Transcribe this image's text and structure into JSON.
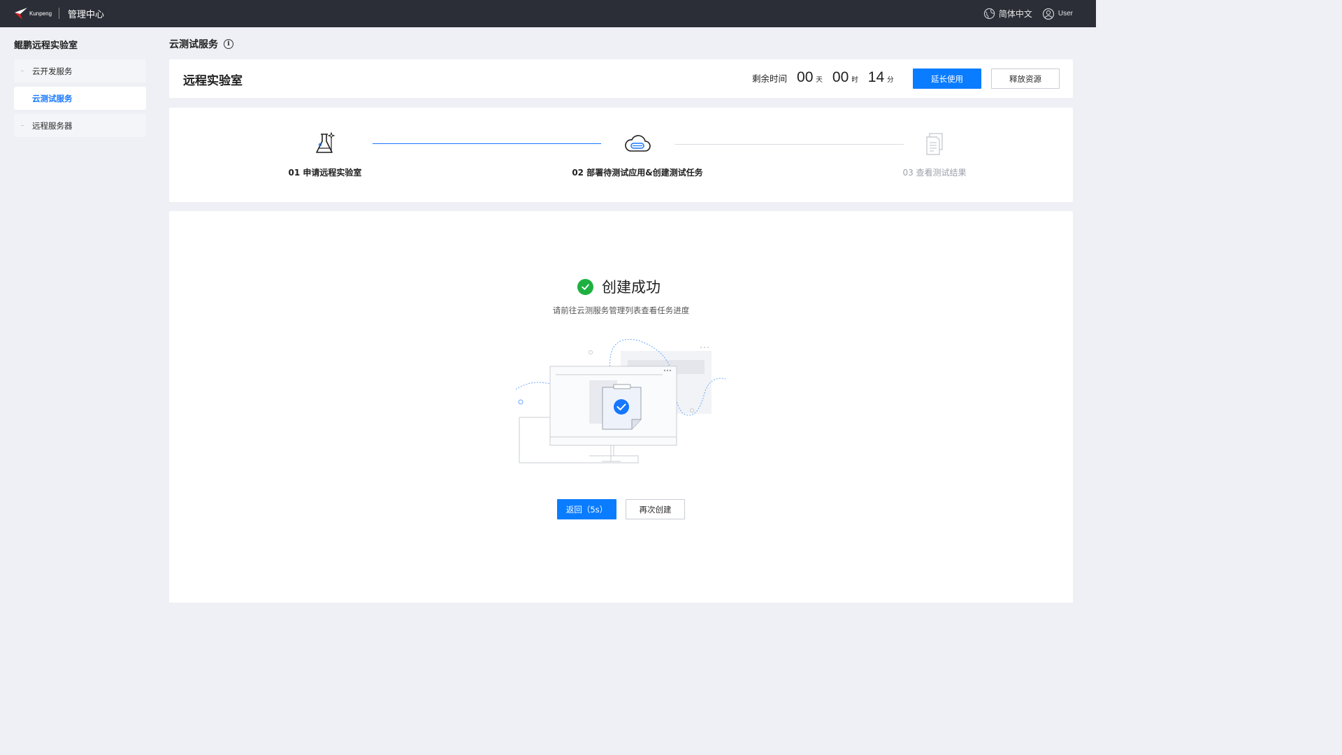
{
  "topbar": {
    "logo_text": "Kunpeng",
    "title": "管理中心",
    "language_label": "简体中文",
    "user_label": "User"
  },
  "sidebar": {
    "title": "鲲鹏远程实验室",
    "items": [
      {
        "label": "云开发服务",
        "active": false
      },
      {
        "label": "云测试服务",
        "active": true
      },
      {
        "label": "远程服务器",
        "active": false
      }
    ]
  },
  "page": {
    "title": "云测试服务",
    "info_icon": "info-icon"
  },
  "lab_header": {
    "title": "远程实验室",
    "remaining_label": "剩余时间",
    "days": "00",
    "days_unit": "天",
    "hours": "00",
    "hours_unit": "时",
    "minutes": "14",
    "minutes_unit": "分",
    "extend_button": "延长使用",
    "release_button": "释放资源"
  },
  "steps": [
    {
      "label": "01 申请远程实验室",
      "icon": "flask-icon",
      "state": "done"
    },
    {
      "label": "02 部署待测试应用&创建测试任务",
      "icon": "cloud-icon",
      "state": "current"
    },
    {
      "label": "03 查看测试结果",
      "icon": "document-icon",
      "state": "pending"
    }
  ],
  "result": {
    "title": "创建成功",
    "subtitle": "请前往云测服务管理列表查看任务进度",
    "back_button": "返回（5s）",
    "recreate_button": "再次创建"
  },
  "colors": {
    "topbar": "#2b2e36",
    "primary": "#0a7cff",
    "success": "#1eb141",
    "active_nav": "#1677ff"
  }
}
